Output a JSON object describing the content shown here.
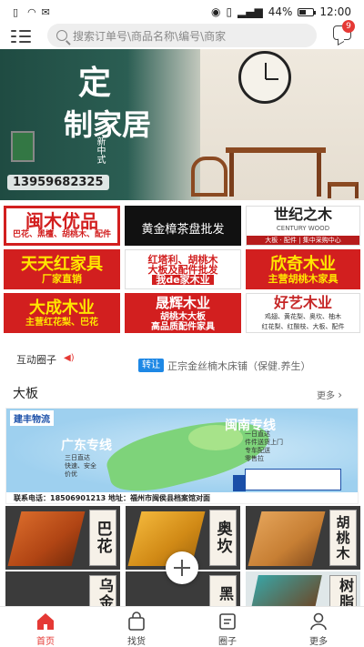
{
  "status_bar": {
    "battery": "44%",
    "time": "12:00"
  },
  "header": {
    "search_placeholder": "搜索订单号\\商品名称\\编号\\商家",
    "message_badge": "9"
  },
  "hero": {
    "title_1": "定",
    "title_2": "制家居",
    "style_text": "新中式",
    "phone": "13959682325"
  },
  "ads": [
    {
      "main": "闽木优品",
      "sub": "巴花、黑檀、胡桃木、配件"
    },
    {
      "main": "黄金樟茶盘批发",
      "sub": ""
    },
    {
      "main": "世纪之木",
      "sub": "CENTURY WOOD",
      "sub2": "大板 · 配件 | 集中采购中心"
    },
    {
      "main": "天天红家具",
      "sub": "厂家直销"
    },
    {
      "main": "红塔利、胡桃木",
      "sub": "大板及配件批发",
      "sub2": "我de家木业"
    },
    {
      "main": "欣奇木业",
      "sub": "主营胡桃木家具"
    },
    {
      "main": "大成木业",
      "sub": "主营红花梨、巴花"
    },
    {
      "main": "晟辉木业",
      "sub": "胡桃木大板",
      "sub2": "高品质配件家具"
    },
    {
      "main": "好艺木业",
      "sub": "鸡翅、黄花梨、奥坎、柚木",
      "sub2": "红花梨、红酸枝、大板、配件"
    }
  ],
  "ticker": {
    "label": "互动圈子",
    "tag": "转让",
    "text": "正宗金丝楠木床铺（保健.养生）"
  },
  "section": {
    "title": "大板",
    "more": "更多"
  },
  "logistics": {
    "brand": "建丰物流",
    "region_left": "广东专线",
    "region_right": "闽南专线",
    "left_bullets": [
      "三日直达",
      "快速、安全",
      "价优"
    ],
    "right_bullets": [
      "一日直达",
      "件件送货上门",
      "专车配送",
      "零售拉"
    ],
    "footer": "联系电话：18506901213    地址：福州市闽侯县档案馆对面"
  },
  "products": [
    {
      "label": "巴花",
      "wood": "#c4541f"
    },
    {
      "label": "奥坎",
      "wood": "#d8951e"
    },
    {
      "label": "胡桃木",
      "wood": "#c77f34"
    },
    {
      "label": "乌金",
      "wood": "#6a4b2e"
    },
    {
      "label": "黑",
      "wood": "#3c2a1e"
    },
    {
      "label": "树脂",
      "wood": "#4aa0a0"
    }
  ],
  "tabs": [
    {
      "label": "首页",
      "active": true
    },
    {
      "label": "找货",
      "active": false
    },
    {
      "label": "圈子",
      "active": false
    },
    {
      "label": "更多",
      "active": false
    }
  ],
  "colors": {
    "accent_red": "#e53935",
    "ticker_tag": "#1e88e5"
  }
}
